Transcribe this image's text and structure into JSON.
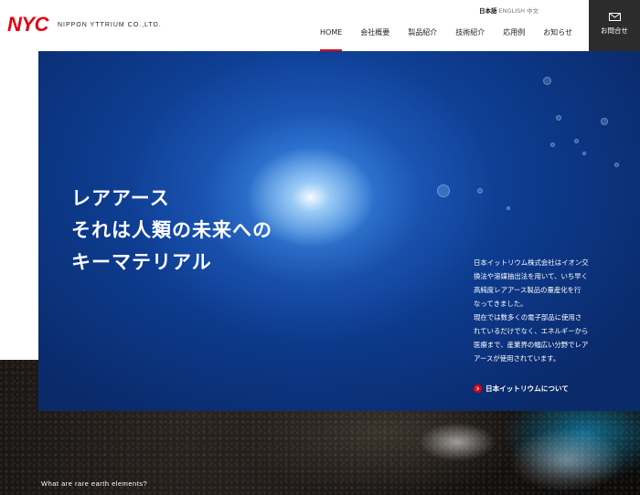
{
  "header": {
    "logo_mark": "NYC",
    "logo_text": "NIPPON YTTRIUM CO.,LTD.",
    "languages": [
      "日本語",
      "ENGLISH",
      "中文"
    ],
    "nav": [
      "HOME",
      "会社概要",
      "製品紹介",
      "技術紹介",
      "応用例",
      "お知らせ"
    ],
    "contact_label": "お問合せ"
  },
  "hero": {
    "title_lines": [
      "レアアース",
      "それは人類の未来への",
      "キーマテリアル"
    ],
    "description_lines": [
      "日本イットリウム株式会社はイオン交",
      "換法や溶媒抽出法を用いて、いち早く",
      "高純度レアアース製品の量産化を行",
      "なってきました。",
      "現在では数多くの電子部品に使用さ",
      "れているだけでなく、エネルギーから",
      "医療まで、産業界の幅広い分野でレア",
      "アースが使用されています。"
    ],
    "about_link": "日本イットリウムについて"
  },
  "section": {
    "caption": "What are rare earth elements?"
  },
  "colors": {
    "brand_red": "#e60012",
    "contact_bg": "#2c2c2c"
  }
}
